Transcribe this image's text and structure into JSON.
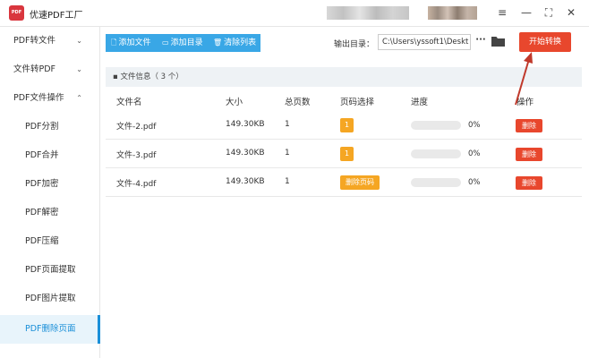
{
  "window": {
    "logo_text": "PDF",
    "title": "优速PDF工厂",
    "menu_icon": "≡",
    "minimize_icon": "—",
    "maximize_icon": "⛶",
    "close_icon": "✕"
  },
  "sidebar": {
    "items": [
      {
        "label": "PDF转文件",
        "chevron": "⌄"
      },
      {
        "label": "文件转PDF",
        "chevron": "⌄"
      },
      {
        "label": "PDF文件操作",
        "chevron": "⌃"
      },
      {
        "label": "PDF分割"
      },
      {
        "label": "PDF合并"
      },
      {
        "label": "PDF加密"
      },
      {
        "label": "PDF解密"
      },
      {
        "label": "PDF压缩"
      },
      {
        "label": "PDF页面提取"
      },
      {
        "label": "PDF图片提取"
      },
      {
        "label": "PDF删除页面"
      }
    ],
    "active_index": 10
  },
  "toolbar": {
    "add_file": "添加文件",
    "add_dir": "添加目录",
    "clear_list": "清除列表",
    "output_label": "输出目录：",
    "output_path": "C:\\Users\\yssoft1\\Deskt",
    "more_label": "···",
    "start_label": "开始转换"
  },
  "panel": {
    "header": "文件信息（ 3 个）"
  },
  "table": {
    "columns": [
      "文件名",
      "大小",
      "总页数",
      "页码选择",
      "进度",
      "操作"
    ],
    "rows": [
      {
        "name": "文件-2.pdf",
        "size": "149.30KB",
        "pages": "1",
        "page_select": "1",
        "progress": 0,
        "pct": "0%",
        "action": "删除"
      },
      {
        "name": "文件-3.pdf",
        "size": "149.30KB",
        "pages": "1",
        "page_select": "1",
        "progress": 0,
        "pct": "0%",
        "action": "删除"
      },
      {
        "name": "文件-4.pdf",
        "size": "149.30KB",
        "pages": "1",
        "page_select": "删除页码",
        "progress": 0,
        "pct": "0%",
        "action": "删除"
      }
    ]
  },
  "colors": {
    "accent": "#39a7e6",
    "start_button": "#e8472d",
    "badge": "#f5a623",
    "annotation_arrow": "#c0392b"
  }
}
